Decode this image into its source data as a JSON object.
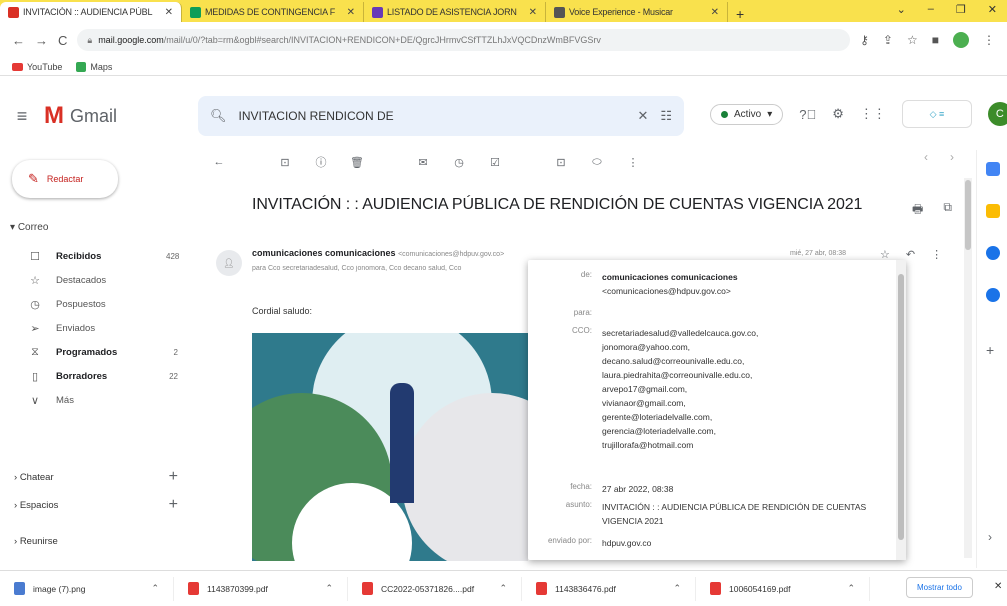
{
  "browser": {
    "tabs": [
      {
        "title": "INVITACIÓN :: AUDIENCIA PÚBL",
        "color": "#d93025",
        "active": true
      },
      {
        "title": "MEDIDAS DE CONTINGENCIA F",
        "color": "#0f9d58",
        "active": false
      },
      {
        "title": "LISTADO DE ASISTENCIA JORN",
        "color": "#673ab7",
        "active": false
      },
      {
        "title": "Voice Experience - Musicar",
        "color": "#555555",
        "active": false
      }
    ],
    "new_tab": "+",
    "url_domain": "mail.google.com",
    "url_path": "/mail/u/0/?tab=rm&ogbl#search/INVITACION+RENDICON+DE/QgrcJHrmvCSfTTZLhJxVQCDnzWmBFVGSrv",
    "bookmarks": [
      {
        "label": "YouTube",
        "icon": "youtube-icon"
      },
      {
        "label": "Maps",
        "icon": "maps-icon"
      }
    ]
  },
  "gmail": {
    "logo_text": "Gmail",
    "search_value": "INVITACION RENDICON DE",
    "status": "Activo",
    "brand_text": "",
    "avatar_letter": "C",
    "compose": "Redactar",
    "sections": {
      "mail": "Correo",
      "chat": "Chatear",
      "spaces": "Espacios",
      "meet": "Reunirse"
    },
    "nav": [
      {
        "label": "Recibidos",
        "count": "428",
        "icon": "inbox-icon",
        "glyph": "☐",
        "bold": true
      },
      {
        "label": "Destacados",
        "count": "",
        "icon": "star-icon",
        "glyph": "☆",
        "bold": false
      },
      {
        "label": "Pospuestos",
        "count": "",
        "icon": "clock-icon",
        "glyph": "◷",
        "bold": false
      },
      {
        "label": "Enviados",
        "count": "",
        "icon": "send-icon",
        "glyph": "➢",
        "bold": false
      },
      {
        "label": "Programados",
        "count": "2",
        "icon": "scheduled-icon",
        "glyph": "⧖",
        "bold": true
      },
      {
        "label": "Borradores",
        "count": "22",
        "icon": "draft-icon",
        "glyph": "▯",
        "bold": true
      },
      {
        "label": "Más",
        "count": "",
        "icon": "chevron-down-icon",
        "glyph": "∨",
        "bold": false
      }
    ]
  },
  "email": {
    "subject": "INVITACIÓN : : AUDIENCIA PÚBLICA DE RENDICIÓN DE CUENTAS VIGENCIA 2021",
    "sender_name": "comunicaciones comunicaciones",
    "sender_email": "<comunicaciones@hdpuv.gov.co>",
    "to_line": "para Cco secretariadesalud, Cco jonomora, Cco decano salud, Cco",
    "date": "mié, 27 abr, 08:38",
    "greeting": "Cordial saludo:",
    "details": {
      "de_label": "de:",
      "de_name": "comunicaciones comunicaciones",
      "de_email": "<comunicaciones@hdpuv.gov.co>",
      "para_label": "para:",
      "cco_label": "CCO:",
      "cco": [
        "secretariadesalud@valledelcauca.gov.co,",
        "jonomora@yahoo.com,",
        "decano.salud@correounivalle.edu.co,",
        "laura.piedrahita@correounivalle.edu.co,",
        "arvepo17@gmail.com,",
        "vivianaor@gmail.com,",
        "gerente@loteriadelvalle.com,",
        "gerencia@loteriadelvalle.com,",
        "trujillorafa@hotmail.com"
      ],
      "fecha_label": "fecha:",
      "fecha": "27 abr 2022, 08:38",
      "asunto_label": "asunto:",
      "asunto": "INVITACIÓN : : AUDIENCIA PÚBLICA DE RENDICIÓN DE CUENTAS VIGENCIA 2021",
      "enviado_label": "enviado por:",
      "enviado": "hdpuv.gov.co"
    }
  },
  "downloads": {
    "items": [
      {
        "name": "image (7).png",
        "kind": "png"
      },
      {
        "name": "1143870399.pdf",
        "kind": "pdf"
      },
      {
        "name": "CC2022-05371826....pdf",
        "kind": "pdf"
      },
      {
        "name": "1143836476.pdf",
        "kind": "pdf"
      },
      {
        "name": "1006054169.pdf",
        "kind": "pdf"
      }
    ],
    "show_all": "Mostrar todo"
  },
  "colors": {
    "tabbar": "#f9e14d",
    "accent_red": "#d93025",
    "search_bg": "#eaf1fb",
    "active_green": "#188038"
  }
}
